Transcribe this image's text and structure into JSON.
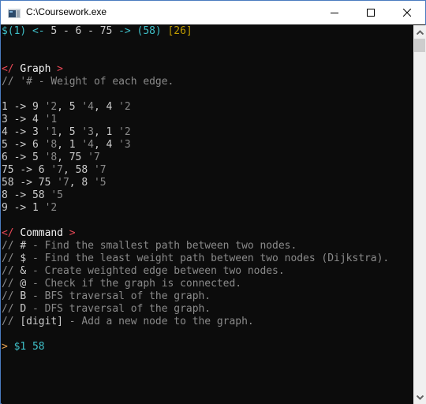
{
  "window": {
    "title": "C:\\Coursework.exe",
    "icon": "console-app-icon",
    "controls": [
      "minimize-icon",
      "maximize-icon",
      "close-icon"
    ]
  },
  "terminal": {
    "path_line": {
      "start": "$(1)",
      "arrow_left": "<-",
      "middle": "5 - 6 - 75",
      "arrow_right": "->",
      "end": "(58)",
      "total": "[26]"
    },
    "graph_section": {
      "open": "</",
      "title": "Graph",
      "close": ">",
      "comment": "// '# - Weight of each edge.",
      "edges": [
        {
          "node": "1",
          "targets": [
            {
              "to": "9",
              "w": "'2"
            },
            {
              "to": "5",
              "w": "'4"
            },
            {
              "to": "4",
              "w": "'2"
            }
          ]
        },
        {
          "node": "3",
          "targets": [
            {
              "to": "4",
              "w": "'1"
            }
          ]
        },
        {
          "node": "4",
          "targets": [
            {
              "to": "3",
              "w": "'1"
            },
            {
              "to": "5",
              "w": "'3"
            },
            {
              "to": "1",
              "w": "'2"
            }
          ]
        },
        {
          "node": "5",
          "targets": [
            {
              "to": "6",
              "w": "'8"
            },
            {
              "to": "1",
              "w": "'4"
            },
            {
              "to": "4",
              "w": "'3"
            }
          ]
        },
        {
          "node": "6",
          "targets": [
            {
              "to": "5",
              "w": "'8"
            },
            {
              "to": "75",
              "w": "'7"
            }
          ]
        },
        {
          "node": "75",
          "targets": [
            {
              "to": "6",
              "w": "'7"
            },
            {
              "to": "58",
              "w": "'7"
            }
          ]
        },
        {
          "node": "58",
          "targets": [
            {
              "to": "75",
              "w": "'7"
            },
            {
              "to": "8",
              "w": "'5"
            }
          ]
        },
        {
          "node": "8",
          "targets": [
            {
              "to": "58",
              "w": "'5"
            }
          ]
        },
        {
          "node": "9",
          "targets": [
            {
              "to": "1",
              "w": "'2"
            }
          ]
        }
      ]
    },
    "command_section": {
      "open": "</",
      "title": "Command",
      "close": ">",
      "commands": [
        {
          "key": "#",
          "desc": "- Find the smallest path between two nodes."
        },
        {
          "key": "$",
          "desc": "- Find the least weight path between two nodes (Dijkstra)."
        },
        {
          "key": "&",
          "desc": "- Create weighted edge between two nodes."
        },
        {
          "key": "@",
          "desc": "- Check if the graph is connected."
        },
        {
          "key": "B",
          "desc": "- BFS traversal of the graph."
        },
        {
          "key": "D",
          "desc": "- DFS traversal of the graph."
        },
        {
          "key": "[digit]",
          "desc": "- Add a new node to the graph."
        }
      ]
    },
    "prompt": {
      "symbol": ">",
      "input": "$1 58"
    }
  },
  "colors": {
    "background": "#0c0c0c",
    "cyan": "#3fc0c9",
    "gold": "#c19c00",
    "red": "#e74856",
    "comment_gray": "#8a8a8a",
    "text": "#cccccc"
  }
}
